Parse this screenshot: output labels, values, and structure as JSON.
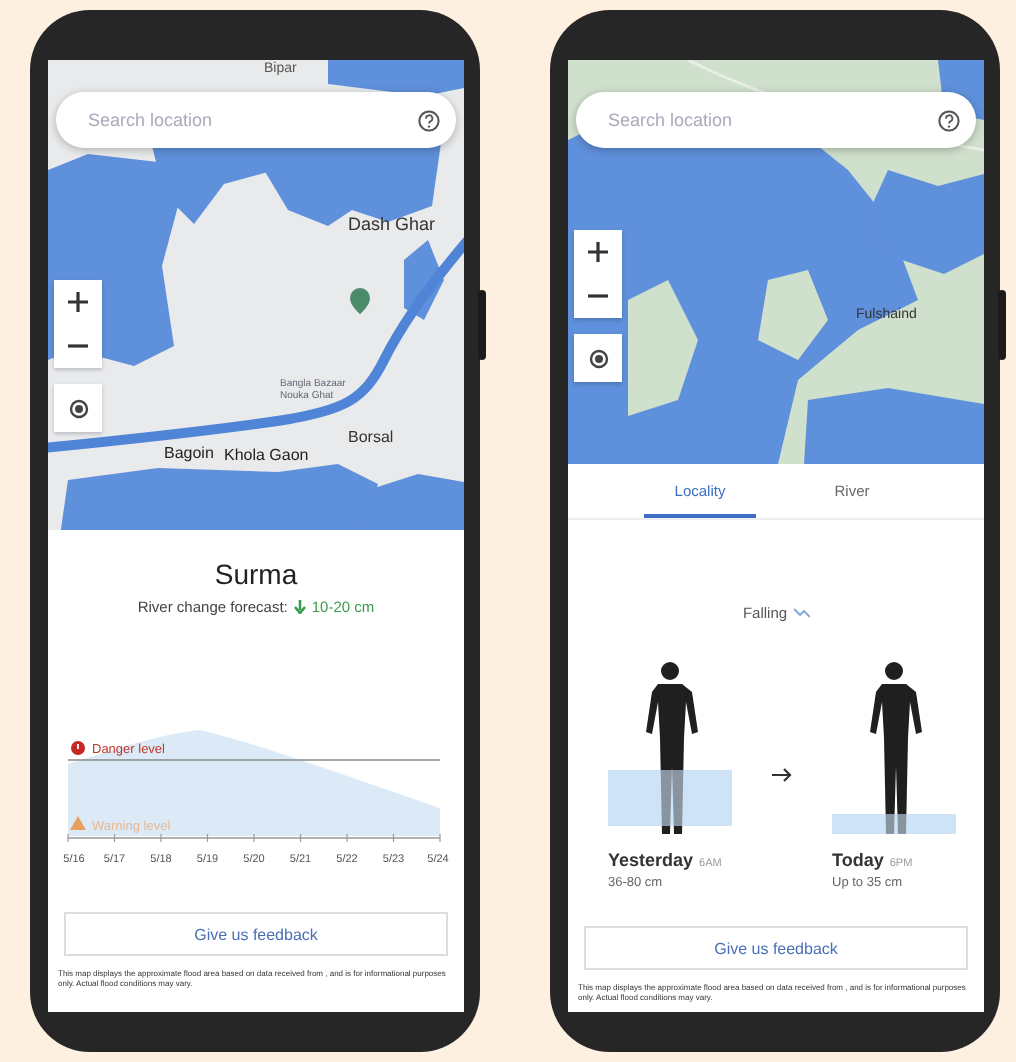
{
  "river_phone": {
    "search": {
      "placeholder": "Search location"
    },
    "map_labels": [
      "Bipar",
      "Dash Ghar",
      "Bangla Bazaar Nouka Ghat",
      "Borsal",
      "Bagoin",
      "Khola Gaon"
    ],
    "river_name": "Surma",
    "forecast_label": "River change forecast:",
    "forecast_value": "10-20 cm",
    "danger_label": "Danger level",
    "warning_label": "Warning level",
    "x_ticks": [
      "5/16",
      "5/17",
      "5/18",
      "5/19",
      "5/20",
      "5/21",
      "5/22",
      "5/23",
      "5/24"
    ],
    "feedback_button": "Give us feedback",
    "disclaimer": "This map displays the approximate flood area based on data received from , and is for informational purposes only. Actual flood conditions may vary."
  },
  "locality_phone": {
    "search": {
      "placeholder": "Search location"
    },
    "map_labels": [
      "Fulshaind"
    ],
    "tabs": [
      {
        "label": "Locality",
        "selected": true
      },
      {
        "label": "River",
        "selected": false
      }
    ],
    "trend": "Falling",
    "readings": [
      {
        "day": "Yesterday",
        "time": "6AM",
        "range": "36-80 cm",
        "kind": "deep"
      },
      {
        "day": "Today",
        "time": "6PM",
        "range": "Up to 35 cm",
        "kind": "shallow"
      }
    ],
    "feedback_button": "Give us feedback",
    "disclaimer": "This map displays the approximate flood area based on data received from , and is for informational purposes only. Actual flood conditions may vary."
  }
}
